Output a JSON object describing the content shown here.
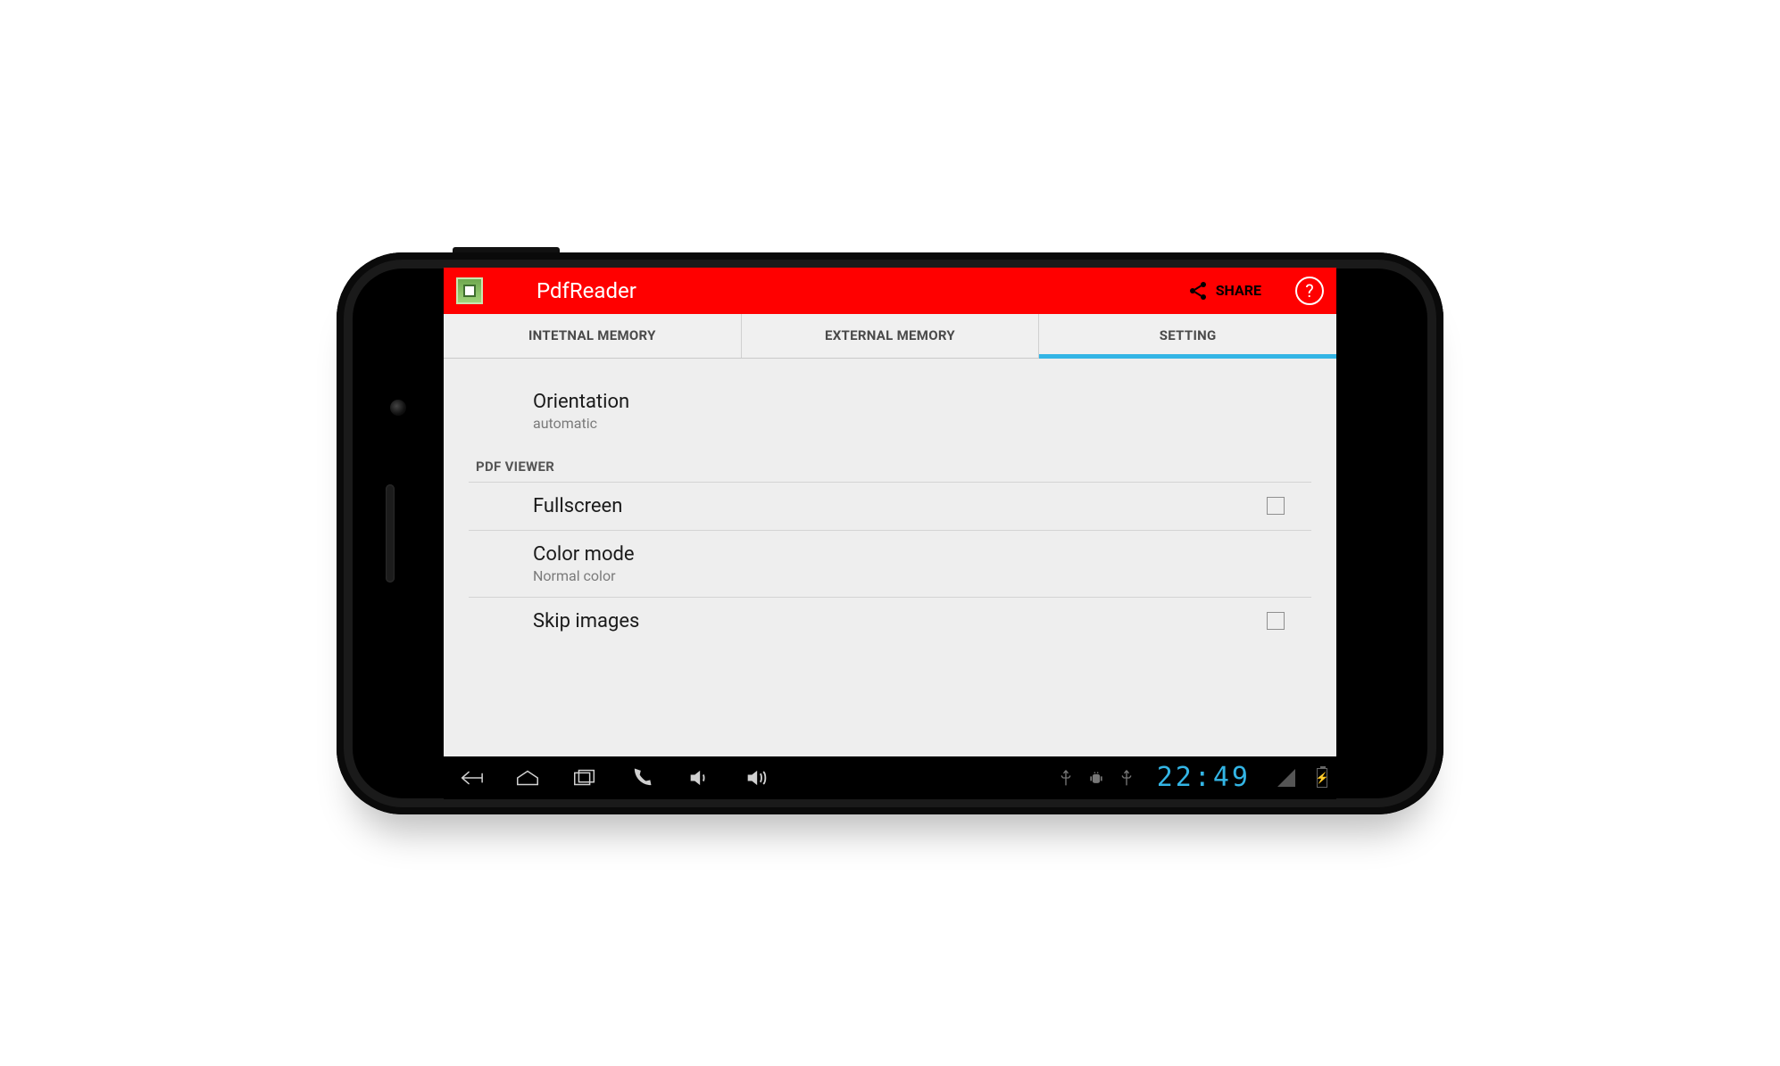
{
  "actionbar": {
    "title": "PdfReader",
    "share_label": "SHARE",
    "help_label": "?"
  },
  "tabs": [
    {
      "label": "INTETNAL MEMORY",
      "active": false
    },
    {
      "label": "EXTERNAL MEMORY",
      "active": false
    },
    {
      "label": "SETTING",
      "active": true
    }
  ],
  "settings": {
    "orientation": {
      "title": "Orientation",
      "summary": "automatic"
    },
    "section_pdf_viewer": "PDF VIEWER",
    "fullscreen": {
      "title": "Fullscreen",
      "checked": false
    },
    "color_mode": {
      "title": "Color mode",
      "summary": "Normal color"
    },
    "skip_images": {
      "title": "Skip images",
      "checked": false
    }
  },
  "statusbar": {
    "time": "22:49"
  }
}
